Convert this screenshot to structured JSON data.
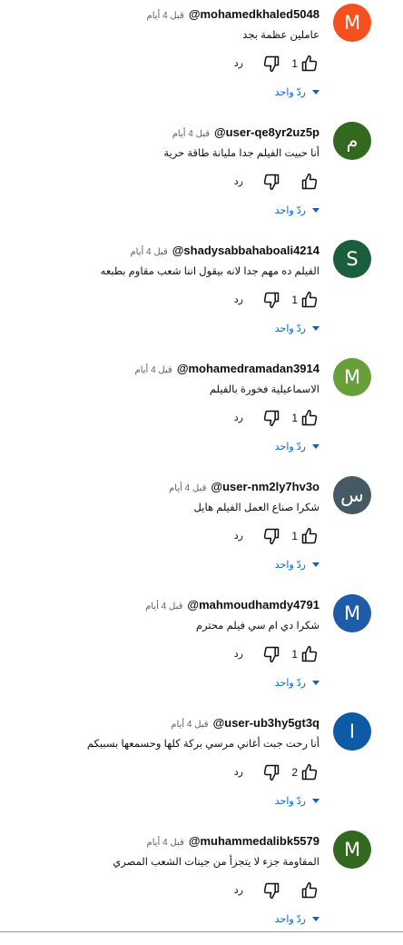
{
  "icons": {
    "like": "thumbs-up-icon",
    "dislike": "thumbs-down-icon",
    "expand": "caret-down-icon"
  },
  "comments": [
    {
      "avatar_letter": "M",
      "avatar_color": "#f4511e",
      "handle": "@mohamedkhaled5048",
      "time": "قبل 4 أيام",
      "text": "عاملين عظمة بجد",
      "likes": "1",
      "reply_label": "رد",
      "replies_label": "ردّ واحد"
    },
    {
      "avatar_letter": "م",
      "avatar_color": "#33691e",
      "handle": "@user-qe8yr2uz5p",
      "time": "قبل 4 أيام",
      "text": "أنا حبيت الفيلم جدا مليانة طاقة حرية",
      "likes": "",
      "reply_label": "رد",
      "replies_label": "ردّ واحد"
    },
    {
      "avatar_letter": "S",
      "avatar_color": "#1b5e3b",
      "handle": "@shadysabbahaboali4214",
      "time": "قبل 4 أيام",
      "text": "الفيلم ده مهم جدا لانه بيقول اننا شعب مقاوم بطبعه",
      "likes": "1",
      "reply_label": "رد",
      "replies_label": "ردّ واحد"
    },
    {
      "avatar_letter": "M",
      "avatar_color": "#689f38",
      "handle": "@mohamedramadan3914",
      "time": "قبل 4 أيام",
      "text": "الاسماعيلية فخورة بالفيلم",
      "likes": "1",
      "reply_label": "رد",
      "replies_label": "ردّ واحد"
    },
    {
      "avatar_letter": "س",
      "avatar_color": "#455a64",
      "handle": "@user-nm2ly7hv3o",
      "time": "قبل 4 أيام",
      "text": "شكرا صناع العمل الفيلم هايل",
      "likes": "1",
      "reply_label": "رد",
      "replies_label": "ردّ واحد"
    },
    {
      "avatar_letter": "M",
      "avatar_color": "#1e5ba8",
      "handle": "@mahmoudhamdy4791",
      "time": "قبل 4 أيام",
      "text": "شكرا دي ام سي فيلم محترم",
      "likes": "1",
      "reply_label": "رد",
      "replies_label": "ردّ واحد"
    },
    {
      "avatar_letter": "I",
      "avatar_color": "#0d5aa7",
      "handle": "@user-ub3hy5gt3q",
      "time": "قبل 4 أيام",
      "text": "أنا رحت جبت أغاني مرسي بركة كلها وحسمعها بسببكم",
      "likes": "2",
      "reply_label": "رد",
      "replies_label": "ردّ واحد"
    },
    {
      "avatar_letter": "M",
      "avatar_color": "#33691e",
      "handle": "@muhammedalibk5579",
      "time": "قبل 4 أيام",
      "text": "المقاومة جزء لا يتجزأ من جينات الشعب المصري",
      "likes": "",
      "reply_label": "رد",
      "replies_label": "ردّ واحد"
    }
  ]
}
